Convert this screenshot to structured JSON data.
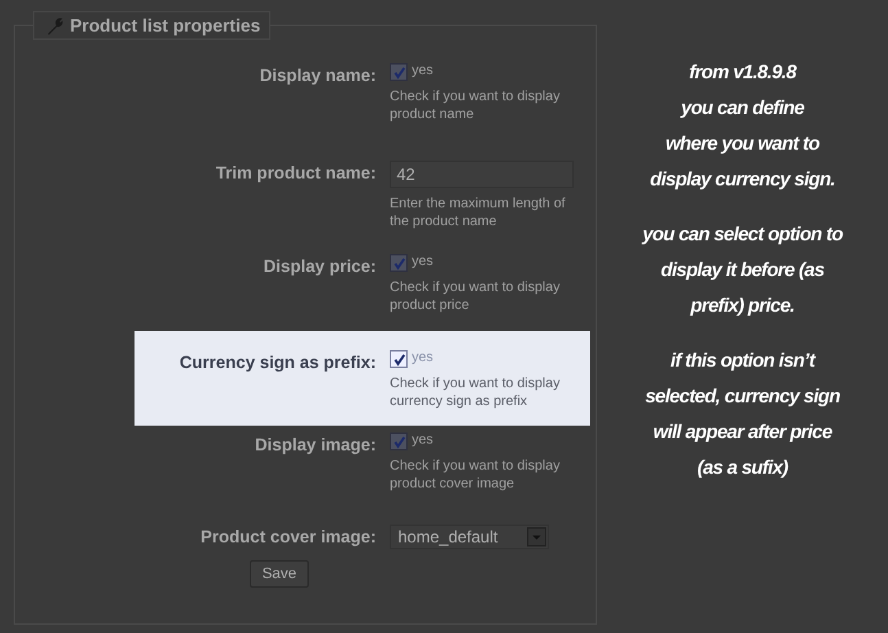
{
  "panel": {
    "title": "Product list properties"
  },
  "fields": [
    {
      "kind": "checkbox",
      "label": "Display name:",
      "checked": true,
      "option": "yes",
      "help": "Check if you want to display product name",
      "highlighted": false
    },
    {
      "kind": "text",
      "label": "Trim product name:",
      "value": "42",
      "help": "Enter the maximum length of the product name",
      "highlighted": false
    },
    {
      "kind": "checkbox",
      "label": "Display price:",
      "checked": true,
      "option": "yes",
      "help": "Check if you want to display product price",
      "highlighted": false
    },
    {
      "kind": "checkbox",
      "label": "Currency sign as prefix:",
      "checked": true,
      "option": "yes",
      "help": "Check if you want to display currency sign as prefix",
      "highlighted": true
    },
    {
      "kind": "checkbox",
      "label": "Display image:",
      "checked": true,
      "option": "yes",
      "help": "Check if you want to display product cover image",
      "highlighted": false
    },
    {
      "kind": "select",
      "label": "Product cover image:",
      "value": "home_default",
      "highlighted": false
    }
  ],
  "save_button": "Save",
  "note": [
    [
      "from v1.8.9.8",
      "you can define",
      "where you want to",
      "display currency sign."
    ],
    [
      "you can select option to",
      "display it before (as",
      "prefix) price."
    ],
    [
      "if this option isn’t",
      "selected,  currency sign",
      "will appear after price",
      "(as a sufix)"
    ]
  ]
}
